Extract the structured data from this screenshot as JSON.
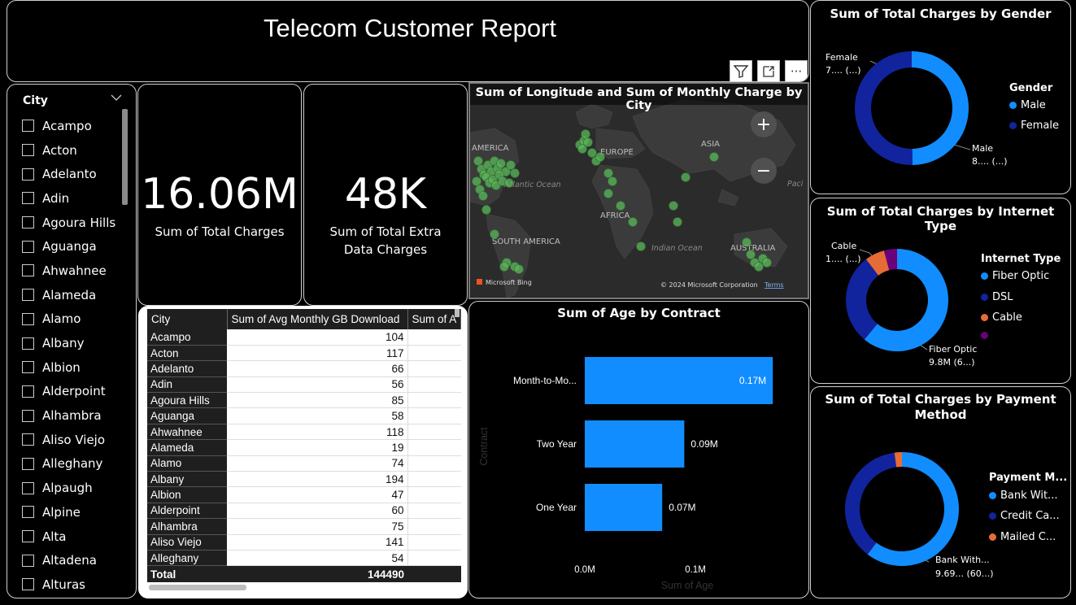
{
  "header": {
    "title": "Telecom Customer Report"
  },
  "visual_tools": {
    "filter_icon": "filter-icon",
    "focus_icon": "focus-mode-icon",
    "more_icon": "more-options-icon",
    "more_label": "···"
  },
  "slicer": {
    "title": "City",
    "items": [
      "Acampo",
      "Acton",
      "Adelanto",
      "Adin",
      "Agoura Hills",
      "Aguanga",
      "Ahwahnee",
      "Alameda",
      "Alamo",
      "Albany",
      "Albion",
      "Alderpoint",
      "Alhambra",
      "Aliso Viejo",
      "Alleghany",
      "Alpaugh",
      "Alpine",
      "Alta",
      "Altadena",
      "Alturas"
    ]
  },
  "cards": [
    {
      "value": "16.06M",
      "label": "Sum of Total Charges"
    },
    {
      "value": "48K",
      "label": "Sum of Total Extra Data Charges"
    }
  ],
  "table": {
    "columns": [
      "City",
      "Sum of Avg Monthly GB Download",
      "Sum of A"
    ],
    "rows": [
      [
        "Acampo",
        "104"
      ],
      [
        "Acton",
        "117"
      ],
      [
        "Adelanto",
        "66"
      ],
      [
        "Adin",
        "56"
      ],
      [
        "Agoura Hills",
        "85"
      ],
      [
        "Aguanga",
        "58"
      ],
      [
        "Ahwahnee",
        "118"
      ],
      [
        "Alameda",
        "19"
      ],
      [
        "Alamo",
        "74"
      ],
      [
        "Albany",
        "194"
      ],
      [
        "Albion",
        "47"
      ],
      [
        "Alderpoint",
        "60"
      ],
      [
        "Alhambra",
        "75"
      ],
      [
        "Aliso Viejo",
        "141"
      ],
      [
        "Alleghany",
        "54"
      ]
    ],
    "total_label": "Total",
    "total_value": "144490"
  },
  "map": {
    "title": "Sum of Longitude and Sum of Monthly Charge by City",
    "labels": {
      "na": "AMERICA",
      "eu": "EUROPE",
      "asia": "ASIA",
      "atl": "Atlantic Ocean",
      "africa": "AFRICA",
      "sa": "SOUTH AMERICA",
      "indian": "Indian Ocean",
      "aus": "AUSTRALIA",
      "pac": "Paci"
    },
    "zoom_in": "+",
    "zoom_out": "−",
    "bing": "Microsoft Bing",
    "copyright": "© 2024 Microsoft Corporation",
    "terms": "Terms"
  },
  "bar_chart": {
    "title": "Sum of Age by Contract",
    "x_axis_label": "Sum of Age",
    "y_axis_label": "Contract",
    "tick_labels": [
      "0.0M",
      "0.1M"
    ],
    "category_labels": [
      "Month-to-Mo...",
      "Two Year",
      "One Year"
    ],
    "data_labels": [
      "0.17M",
      "0.09M",
      "0.07M"
    ],
    "color": "#118dff"
  },
  "chart_data": [
    {
      "type": "bar",
      "orientation": "horizontal",
      "title": "Sum of Age by Contract",
      "xlabel": "Sum of Age",
      "ylabel": "Contract",
      "categories": [
        "Month-to-Month",
        "Two Year",
        "One Year"
      ],
      "values": [
        170000,
        90000,
        70000
      ],
      "xlim": [
        0,
        200000
      ],
      "ticks": [
        "0.0M",
        "0.1M"
      ]
    },
    {
      "type": "pie",
      "donut": true,
      "title": "Sum of Total Charges by Gender",
      "categories": [
        "Male",
        "Female"
      ],
      "values": [
        8.0,
        8.06
      ],
      "colors": [
        "#118dff",
        "#12239e"
      ]
    },
    {
      "type": "pie",
      "donut": true,
      "title": "Sum of Total Charges by Internet Type",
      "categories": [
        "Fiber Optic",
        "DSL",
        "Cable",
        ""
      ],
      "values": [
        9.8,
        4.6,
        1.0,
        0.66
      ],
      "colors": [
        "#118dff",
        "#12239e",
        "#e66c37",
        "#6b007b"
      ]
    },
    {
      "type": "pie",
      "donut": true,
      "title": "Sum of Total Charges by Payment Method",
      "categories": [
        "Bank Wit...",
        "Credit Ca...",
        "Mailed C..."
      ],
      "values": [
        9.69,
        6.03,
        0.34
      ],
      "colors": [
        "#118dff",
        "#12239e",
        "#e66c37"
      ]
    }
  ],
  "donuts": {
    "gender": {
      "title": "Sum of Total Charges by Gender",
      "legend_title": "Gender",
      "legend": [
        "Male",
        "Female"
      ],
      "label_a_name": "Female",
      "label_a_val": "7.... (...)",
      "label_b_name": "Male",
      "label_b_val": "8.... (...)"
    },
    "internet": {
      "title": "Sum of Total Charges by Internet Type",
      "legend_title": "Internet Type",
      "legend": [
        "Fiber Optic",
        "DSL",
        "Cable",
        ""
      ],
      "label_a_name": "Cable",
      "label_a_val": "1.... (...)",
      "label_b_name": "Fiber Optic",
      "label_b_val": "9.8M (6...)"
    },
    "payment": {
      "title_line1": "Sum of Total Charges by Payment",
      "title_line2": "Method",
      "legend_title": "Payment M...",
      "legend": [
        "Bank Wit...",
        "Credit Ca...",
        "Mailed C..."
      ],
      "label_b_name": "Bank With...",
      "label_b_val": "9.69... (60...)"
    }
  }
}
